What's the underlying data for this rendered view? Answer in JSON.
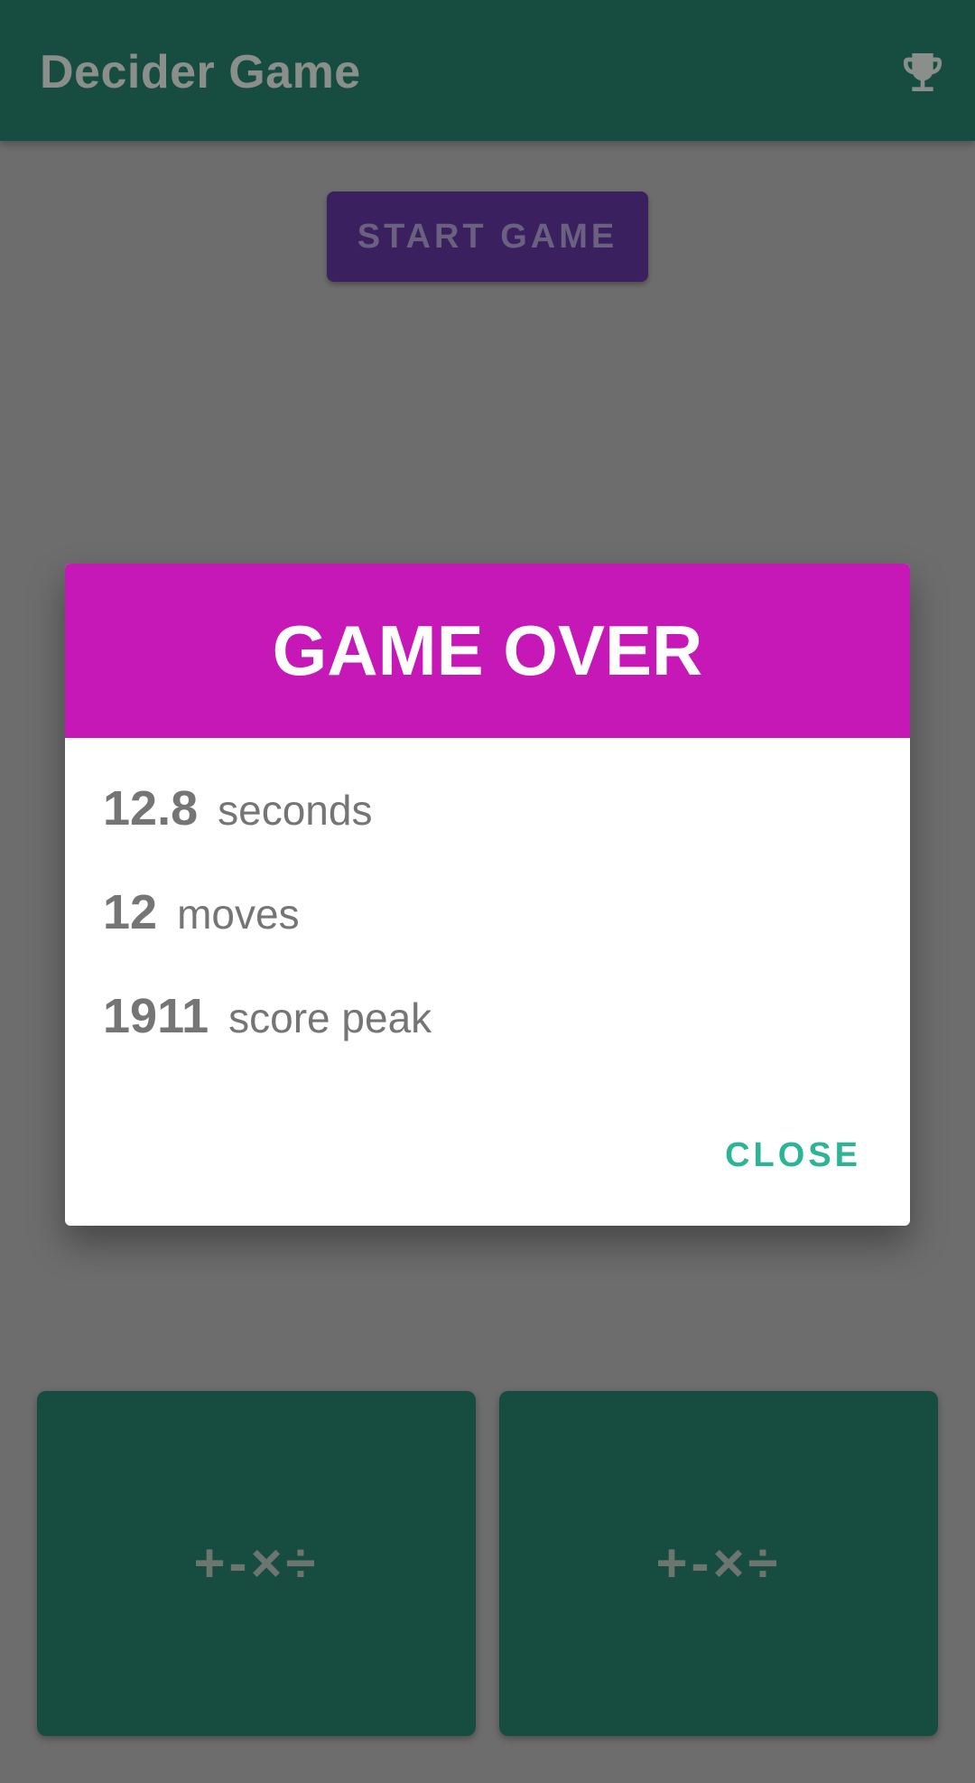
{
  "app_bar": {
    "title": "Decider Game",
    "action_icon": "trophy-icon"
  },
  "start_button": {
    "label": "START GAME"
  },
  "dialog": {
    "title": "GAME OVER",
    "stats": [
      {
        "value": "12.8",
        "label": "seconds"
      },
      {
        "value": "12",
        "label": "moves"
      },
      {
        "value": "1911",
        "label": "score peak"
      }
    ],
    "close_label": "CLOSE"
  },
  "tiles": [
    {
      "label": "+-×÷"
    },
    {
      "label": "+-×÷"
    }
  ],
  "colors": {
    "app_bar": "#174d40",
    "dialog_header": "#c618b7",
    "start_button": "#3b2060",
    "close_accent": "#2bb495",
    "scrim_background": "#6d6d6d"
  }
}
